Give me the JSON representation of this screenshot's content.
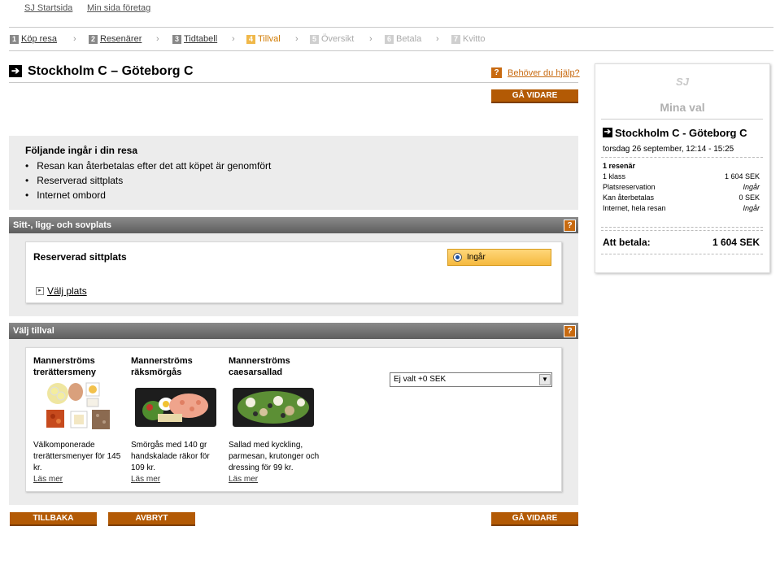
{
  "top_links": {
    "home": "SJ Startsida",
    "company": "Min sida företag"
  },
  "steps": [
    {
      "num": "1",
      "label": "Köp resa"
    },
    {
      "num": "2",
      "label": "Resenärer"
    },
    {
      "num": "3",
      "label": "Tidtabell"
    },
    {
      "num": "4",
      "label": "Tillval"
    },
    {
      "num": "5",
      "label": "Översikt"
    },
    {
      "num": "6",
      "label": "Betala"
    },
    {
      "num": "7",
      "label": "Kvitto"
    }
  ],
  "route_title": "Stockholm C – Göteborg C",
  "help_link": "Behöver du hjälp?",
  "buttons": {
    "next": "GÅ VIDARE",
    "back": "TILLBAKA",
    "cancel": "AVBRYT"
  },
  "included": {
    "heading": "Följande ingår i din resa",
    "items": [
      "Resan kan återbetalas efter det att köpet är genomfört",
      "Reserverad sittplats",
      "Internet ombord"
    ]
  },
  "seat_section": {
    "header": "Sitt-, ligg- och sovplats",
    "label": "Reserverad sittplats",
    "option": "Ingår",
    "choose_seat": "Välj plats"
  },
  "extras_section": {
    "header": "Välj tillval",
    "products": [
      {
        "name": "Mannerströms trerättersmeny",
        "desc": "Välkomponerade trerättersmenyer för 145 kr.",
        "more": "Läs mer"
      },
      {
        "name": "Mannerströms räksmörgås",
        "desc": "Smörgås med 140 gr handskalade räkor för 109 kr.",
        "more": "Läs mer"
      },
      {
        "name": "Mannerströms caesarsallad",
        "desc": "Sallad med kyckling, parmesan, krutonger och dressing för 99 kr.",
        "more": "Läs mer"
      }
    ],
    "select_value": "Ej valt +0 SEK"
  },
  "summary": {
    "logo": "SJ",
    "heading": "Mina val",
    "route": "Stockholm C - Göteborg C",
    "date": "torsdag 26 september, 12:14 - 15:25",
    "travelers": "1 resenär",
    "rows": [
      {
        "label": "1 klass",
        "value": "1 604 SEK"
      },
      {
        "label": "Platsreservation",
        "value": "Ingår"
      },
      {
        "label": "Kan återbetalas",
        "value": "0 SEK"
      },
      {
        "label": "Internet, hela resan",
        "value": "Ingår"
      }
    ],
    "total_label": "Att betala:",
    "total_value": "1 604 SEK"
  }
}
